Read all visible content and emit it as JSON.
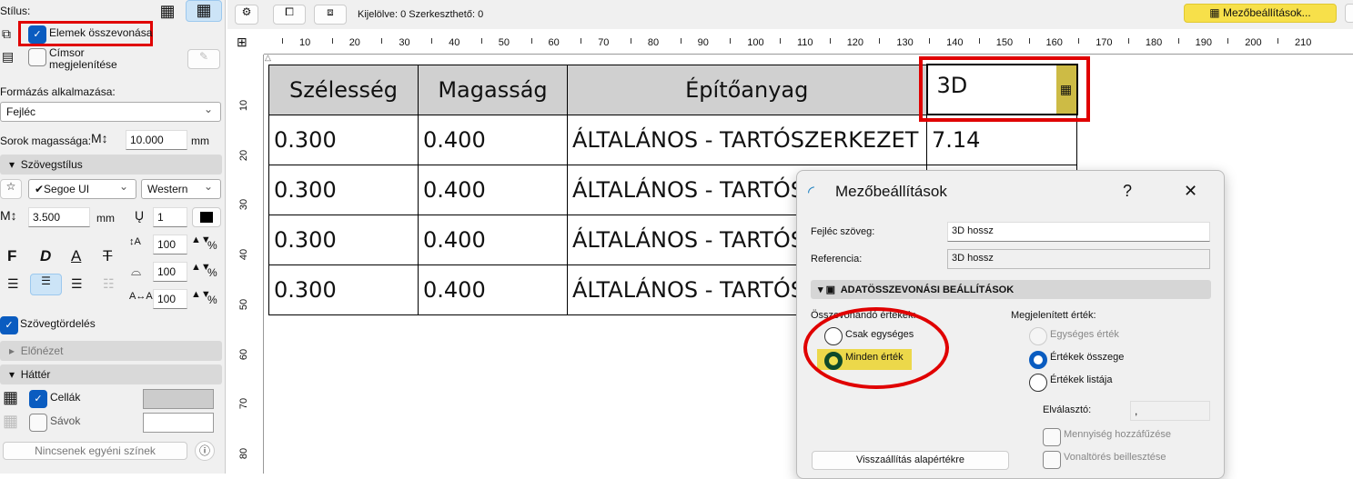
{
  "left_panel": {
    "style_label": "Stílus:",
    "merge_items_label": "Elemek összevonása",
    "merge_items_checked": true,
    "show_header_label_1": "Címsor",
    "show_header_label_2": "megjelenítése",
    "show_header_checked": false,
    "apply_format_label": "Formázás alkalmazása:",
    "apply_format_value": "Fejléc",
    "row_height_label": "Sorok magassága:",
    "row_height_value": "10.000",
    "row_height_unit": "mm",
    "text_style_section": "Szövegstílus",
    "font_value": "✔Segoe UI",
    "charset_value": "Western",
    "text_size_value": "3.500",
    "text_size_unit": "mm",
    "pen_value": "1",
    "bold": "F",
    "italic": "D",
    "underline": "A",
    "strike": "T",
    "line_spacing": "100",
    "width_factor": "100",
    "char_spacing": "100",
    "percent": "%",
    "wrap_label": "Szövegtördelés",
    "wrap_checked": true,
    "preview_section": "Előnézet",
    "background_section": "Háttér",
    "cells_label": "Cellák",
    "cells_checked": true,
    "bands_label": "Sávok",
    "bands_checked": false,
    "no_custom_colors": "Nincsenek egyéni színek",
    "cell_color": "#cccccc",
    "band_color": "#ffffff"
  },
  "toolbar": {
    "status": "Kijelölve: 0  Szerkeszthető: 0",
    "field_settings_button": "Mezőbeállítások..."
  },
  "ruler": {
    "h_labels": [
      "10",
      "20",
      "30",
      "40",
      "50",
      "60",
      "70",
      "80",
      "90",
      "100",
      "110",
      "120",
      "130",
      "140",
      "150",
      "160",
      "170",
      "180",
      "190",
      "200",
      "210"
    ],
    "v_labels": [
      "10",
      "20",
      "30",
      "40",
      "50",
      "60",
      "70",
      "80"
    ]
  },
  "schedule": {
    "headers": [
      "Szélesség",
      "Magasság",
      "Építőanyag",
      "3D"
    ],
    "rows": [
      [
        "0.300",
        "0.400",
        "ÁLTALÁNOS - TARTÓSZERKEZET",
        "7.14"
      ],
      [
        "0.300",
        "0.400",
        "ÁLTALÁNOS - TARTÓSZERKEZET",
        ""
      ],
      [
        "0.300",
        "0.400",
        "ÁLTALÁNOS - TARTÓSZERKEZET",
        ""
      ],
      [
        "0.300",
        "0.400",
        "ÁLTALÁNOS - TARTÓSZERKEZET",
        ""
      ]
    ]
  },
  "dialog": {
    "title": "Mezőbeállítások",
    "help": "?",
    "close": "✕",
    "header_text_label": "Fejléc szöveg:",
    "header_text_value": "3D hossz",
    "reference_label": "Referencia:",
    "reference_value": "3D hossz",
    "section": "ADATÖSSZEVONÁSI BEÁLLÍTÁSOK",
    "merge_values_label": "Összevonandó értékek:",
    "merge_options": [
      "Csak egységes",
      "Minden érték"
    ],
    "merge_selected": 1,
    "display_label": "Megjelenített érték:",
    "display_options": [
      "Egységes érték",
      "Értékek összege",
      "Értékek listája"
    ],
    "display_selected": 1,
    "separator_label": "Elválasztó:",
    "separator_value": ",",
    "append_qty": "Mennyiség hozzáfűzése",
    "insert_linebreak": "Vonaltörés beillesztése",
    "reset_button": "Visszaállítás alapértékre"
  }
}
